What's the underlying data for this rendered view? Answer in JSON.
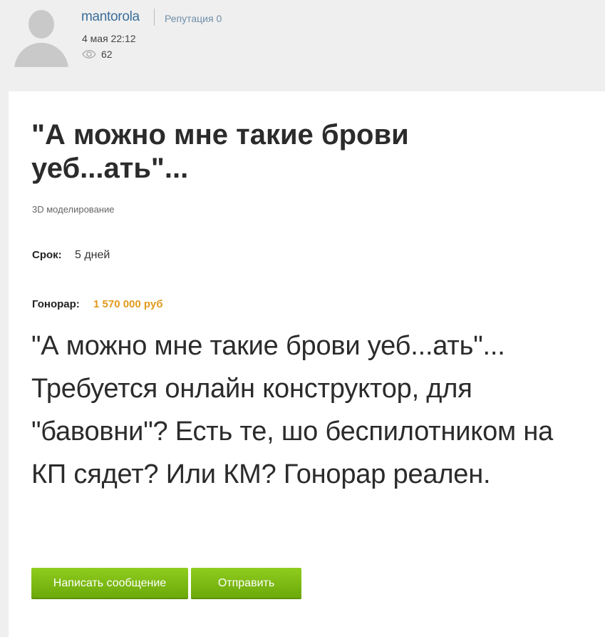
{
  "author": {
    "username": "mantorola",
    "reputation": "Репутация 0",
    "date": "4 мая 22:12",
    "views": "62"
  },
  "icons": {
    "avatar": "user-avatar-placeholder",
    "views": "eye-icon"
  },
  "post": {
    "title": "\"А можно мне такие брови уеб...ать\"...",
    "category": "3D моделирование",
    "deadline_label": "Срок:",
    "deadline_value": "5 дней",
    "fee_label": "Гонорар:",
    "fee_value": "1 570 000 руб",
    "description": "\"А можно мне такие брови уеб...ать\"... Требуется онлайн конструктор, для \"бавовни\"? Есть те, шо беспилотником на КП сядет? Или КМ? Гонорар реален."
  },
  "actions": {
    "message_button": "Написать сообщение",
    "send_button": "Отправить"
  },
  "colors": {
    "username": "#3a6e9a",
    "fee": "#e09a1c",
    "button": "#7ab614",
    "background": "#efefef",
    "card": "#ffffff"
  }
}
